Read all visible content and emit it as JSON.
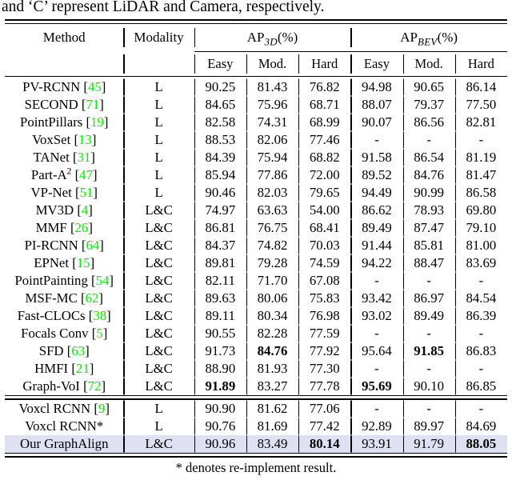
{
  "caption_tail": "and ‘C’ represent LiDAR and Camera, respectively.",
  "footnote": "* denotes re-implement result.",
  "colors": {
    "citation_green": "#00ee00",
    "highlight_row": "#dfe0f2",
    "rule": "#000000"
  },
  "header": {
    "method": "Method",
    "modality": "Modality",
    "group_ap3d_prefix": "AP",
    "group_ap3d_sub": "3D",
    "group_ap3d_suffix": "(%)",
    "group_apbev_prefix": "AP",
    "group_apbev_sub": "BEV",
    "group_apbev_suffix": "(%)",
    "sub": [
      "Easy",
      "Mod.",
      "Hard",
      "Easy",
      "Mod.",
      "Hard"
    ]
  },
  "sections": [
    {
      "rows": [
        {
          "name": "PV-RCNN",
          "cite": "45",
          "modality": "L",
          "values": [
            "90.25",
            "81.43",
            "76.82",
            "94.98",
            "90.65",
            "86.14"
          ],
          "bold": [
            false,
            false,
            false,
            false,
            false,
            false
          ]
        },
        {
          "name": "SECOND",
          "cite": "71",
          "modality": "L",
          "values": [
            "84.65",
            "75.96",
            "68.71",
            "88.07",
            "79.37",
            "77.50"
          ],
          "bold": [
            false,
            false,
            false,
            false,
            false,
            false
          ]
        },
        {
          "name": "PointPillars",
          "cite": "19",
          "modality": "L",
          "values": [
            "82.58",
            "74.31",
            "68.99",
            "90.07",
            "86.56",
            "82.81"
          ],
          "bold": [
            false,
            false,
            false,
            false,
            false,
            false
          ]
        },
        {
          "name": "VoxSet",
          "cite": "13",
          "modality": "L",
          "values": [
            "88.53",
            "82.06",
            "77.46",
            "-",
            "-",
            "-"
          ],
          "bold": [
            false,
            false,
            false,
            false,
            false,
            false
          ]
        },
        {
          "name": "TANet",
          "cite": "31",
          "modality": "L",
          "values": [
            "84.39",
            "75.94",
            "68.82",
            "91.58",
            "86.54",
            "81.19"
          ],
          "bold": [
            false,
            false,
            false,
            false,
            false,
            false
          ]
        },
        {
          "name": "Part-A",
          "sup": "2",
          "cite": "47",
          "modality": "L",
          "values": [
            "85.94",
            "77.86",
            "72.00",
            "89.52",
            "84.76",
            "81.47"
          ],
          "bold": [
            false,
            false,
            false,
            false,
            false,
            false
          ]
        },
        {
          "name": "VP-Net",
          "cite": "51",
          "modality": "L",
          "values": [
            "90.46",
            "82.03",
            "79.65",
            "94.49",
            "90.99",
            "86.58"
          ],
          "bold": [
            false,
            false,
            false,
            false,
            false,
            false
          ]
        },
        {
          "name": "MV3D",
          "cite": "4",
          "modality": "L&C",
          "values": [
            "74.97",
            "63.63",
            "54.00",
            "86.62",
            "78.93",
            "69.80"
          ],
          "bold": [
            false,
            false,
            false,
            false,
            false,
            false
          ]
        },
        {
          "name": "MMF",
          "cite": "26",
          "modality": "L&C",
          "values": [
            "86.81",
            "76.75",
            "68.41",
            "89.49",
            "87.47",
            "79.10"
          ],
          "bold": [
            false,
            false,
            false,
            false,
            false,
            false
          ]
        },
        {
          "name": "PI-RCNN",
          "cite": "64",
          "modality": "L&C",
          "values": [
            "84.37",
            "74.82",
            "70.03",
            "91.44",
            "85.81",
            "81.00"
          ],
          "bold": [
            false,
            false,
            false,
            false,
            false,
            false
          ]
        },
        {
          "name": "EPNet",
          "cite": "15",
          "modality": "L&C",
          "values": [
            "89.81",
            "79.28",
            "74.59",
            "94.22",
            "88.47",
            "83.69"
          ],
          "bold": [
            false,
            false,
            false,
            false,
            false,
            false
          ]
        },
        {
          "name": "PointPainting",
          "cite": "54",
          "modality": "L&C",
          "values": [
            "82.11",
            "71.70",
            "67.08",
            "-",
            "-",
            "-"
          ],
          "bold": [
            false,
            false,
            false,
            false,
            false,
            false
          ]
        },
        {
          "name": "MSF-MC",
          "cite": "62",
          "modality": "L&C",
          "values": [
            "89.63",
            "80.06",
            "75.83",
            "93.42",
            "86.97",
            "84.54"
          ],
          "bold": [
            false,
            false,
            false,
            false,
            false,
            false
          ]
        },
        {
          "name": "Fast-CLOCs",
          "cite": "38",
          "modality": "L&C",
          "values": [
            "89.11",
            "80.34",
            "76.98",
            "93.02",
            "89.49",
            "86.39"
          ],
          "bold": [
            false,
            false,
            false,
            false,
            false,
            false
          ]
        },
        {
          "name": "Focals Conv",
          "cite": "5",
          "modality": "L&C",
          "values": [
            "90.55",
            "82.28",
            "77.59",
            "-",
            "-",
            "-"
          ],
          "bold": [
            false,
            false,
            false,
            false,
            false,
            false
          ]
        },
        {
          "name": "SFD",
          "cite": "63",
          "modality": "L&C",
          "values": [
            "91.73",
            "84.76",
            "77.92",
            "95.64",
            "91.85",
            "86.83"
          ],
          "bold": [
            false,
            true,
            false,
            false,
            true,
            false
          ]
        },
        {
          "name": "HMFI",
          "cite": "21",
          "modality": "L&C",
          "values": [
            "88.90",
            "81.93",
            "77.30",
            "-",
            "-",
            "-"
          ],
          "bold": [
            false,
            false,
            false,
            false,
            false,
            false
          ]
        },
        {
          "name": "Graph-VoI",
          "cite": "72",
          "modality": "L&C",
          "values": [
            "91.89",
            "83.27",
            "77.78",
            "95.69",
            "90.10",
            "86.85"
          ],
          "bold": [
            true,
            false,
            false,
            true,
            false,
            false
          ]
        }
      ]
    },
    {
      "rows": [
        {
          "name": "Voxcl RCNN",
          "cite": "9",
          "modality": "L",
          "values": [
            "90.90",
            "81.62",
            "77.06",
            "-",
            "-",
            "-"
          ],
          "bold": [
            false,
            false,
            false,
            false,
            false,
            false
          ]
        },
        {
          "name": "Voxcl RCNN*",
          "cite": null,
          "modality": "L",
          "values": [
            "90.76",
            "81.69",
            "77.42",
            "92.89",
            "89.97",
            "84.69"
          ],
          "bold": [
            false,
            false,
            false,
            false,
            false,
            false
          ]
        },
        {
          "name": "Our GraphAlign",
          "cite": null,
          "modality": "L&C",
          "values": [
            "90.96",
            "83.49",
            "80.14",
            "93.91",
            "91.79",
            "88.05"
          ],
          "bold": [
            false,
            false,
            true,
            false,
            false,
            true
          ],
          "highlight": true
        }
      ]
    }
  ]
}
